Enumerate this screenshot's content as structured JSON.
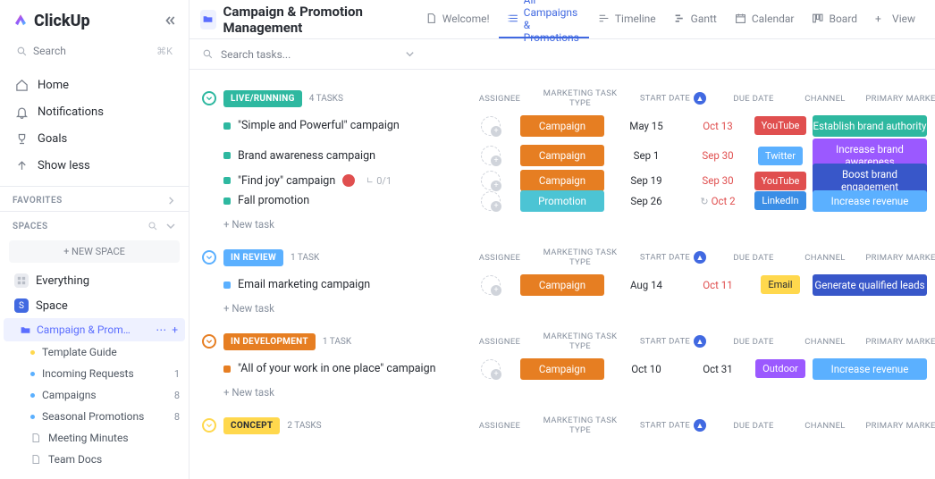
{
  "brand": {
    "name": "ClickUp"
  },
  "sidebar": {
    "search_placeholder": "Search",
    "search_kbd": "⌘K",
    "nav": [
      {
        "label": "Home"
      },
      {
        "label": "Notifications"
      },
      {
        "label": "Goals"
      },
      {
        "label": "Show less"
      }
    ],
    "favorites_label": "FAVORITES",
    "spaces_label": "SPACES",
    "new_space": "+  NEW SPACE",
    "everything": "Everything",
    "space_name": "Space",
    "folder_name": "Campaign & Promotion M…",
    "leaves": [
      {
        "label": "Template Guide",
        "dot": "#ffd84d"
      },
      {
        "label": "Incoming Requests",
        "dot": "#5bb0ff",
        "count": "1"
      },
      {
        "label": "Campaigns",
        "dot": "#5bb0ff",
        "count": "8"
      },
      {
        "label": "Seasonal Promotions",
        "dot": "#5bb0ff",
        "count": "8"
      },
      {
        "label": "Meeting Minutes",
        "icon": "doc"
      },
      {
        "label": "Team Docs",
        "icon": "doc"
      }
    ]
  },
  "header": {
    "title": "Campaign & Promotion Management",
    "views": [
      {
        "label": "Welcome!"
      },
      {
        "label": "All Campaigns & Promotions",
        "active": true
      },
      {
        "label": "Timeline"
      },
      {
        "label": "Gantt"
      },
      {
        "label": "Calendar"
      },
      {
        "label": "Board"
      },
      {
        "label": "View",
        "plus": true
      }
    ],
    "task_search_placeholder": "Search tasks..."
  },
  "cols": {
    "assignee": "ASSIGNEE",
    "type": "MARKETING TASK TYPE",
    "start": "START DATE",
    "due": "DUE DATE",
    "channel": "CHANNEL",
    "goal": "PRIMARY MARKETING GOAL"
  },
  "groups": [
    {
      "status": "LIVE/RUNNING",
      "status_color": "#2eb8a0",
      "task_count": "4 TASKS",
      "tasks": [
        {
          "title": "\"Simple and Powerful\" campaign",
          "dot": "#2eb8a0",
          "type": "Campaign",
          "type_color": "#e67e22",
          "start": "May 15",
          "due": "Oct 13",
          "due_red": true,
          "channel": "YouTube",
          "channel_color": "#e04f4f",
          "goal": "Establish brand authority",
          "goal_color": "#2eb8a0"
        },
        {
          "title": "Brand awareness campaign",
          "dot": "#2eb8a0",
          "type": "Campaign",
          "type_color": "#e67e22",
          "start": "Sep 1",
          "due": "Sep 30",
          "due_red": true,
          "channel": "Twitter",
          "channel_color": "#5bb0ff",
          "goal": "Increase brand awareness",
          "goal_color": "#9b59ff"
        },
        {
          "title": "\"Find joy\" campaign",
          "dot": "#2eb8a0",
          "flag": true,
          "sub": "0/1",
          "type": "Campaign",
          "type_color": "#e67e22",
          "start": "Sep 19",
          "due": "Sep 30",
          "due_red": true,
          "channel": "YouTube",
          "channel_color": "#e04f4f",
          "goal": "Boost brand engagement",
          "goal_color": "#3857c9"
        },
        {
          "title": "Fall promotion",
          "dot": "#2eb8a0",
          "type": "Promotion",
          "type_color": "#4cc4d4",
          "start": "Sep 26",
          "due": "Oct 2",
          "due_red": true,
          "recur": true,
          "channel": "LinkedIn",
          "channel_color": "#3b8ee6",
          "goal": "Increase revenue",
          "goal_color": "#5bb0ff"
        }
      ]
    },
    {
      "status": "IN REVIEW",
      "status_color": "#5bb0ff",
      "task_count": "1 TASK",
      "tasks": [
        {
          "title": "Email marketing campaign",
          "dot": "#5bb0ff",
          "type": "Campaign",
          "type_color": "#e67e22",
          "start": "Aug 14",
          "due": "Oct 11",
          "due_red": true,
          "channel": "Email",
          "channel_color": "#ffd84d",
          "channel_text_dark": true,
          "goal": "Generate qualified leads",
          "goal_color": "#3857c9"
        }
      ]
    },
    {
      "status": "IN DEVELOPMENT",
      "status_color": "#e67e22",
      "task_count": "1 TASK",
      "tasks": [
        {
          "title": "\"All of your work in one place\" campaign",
          "dot": "#e67e22",
          "type": "Campaign",
          "type_color": "#e67e22",
          "start": "Oct 10",
          "due": "Oct 31",
          "channel": "Outdoor",
          "channel_color": "#9b59ff",
          "goal": "Increase revenue",
          "goal_color": "#5bb0ff"
        }
      ]
    },
    {
      "status": "CONCEPT",
      "status_color": "#ffd84d",
      "status_text_dark": true,
      "task_count": "2 TASKS",
      "tasks": []
    }
  ],
  "labels": {
    "new_task": "+ New task"
  }
}
